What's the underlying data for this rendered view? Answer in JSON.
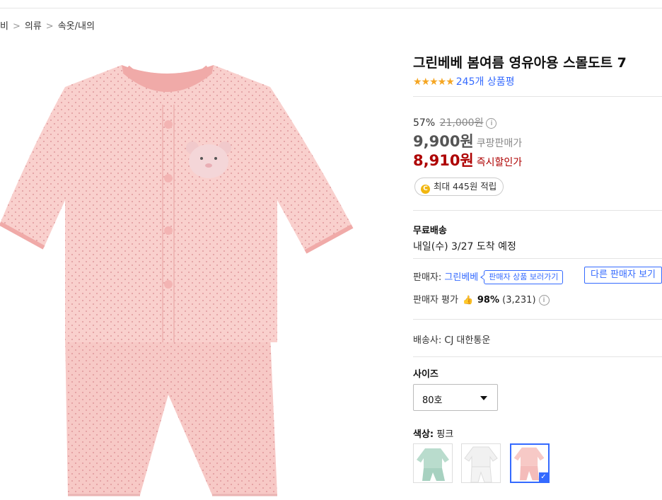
{
  "breadcrumb": {
    "items": [
      "비",
      "의류",
      "속옷/내의"
    ],
    "separator": ">"
  },
  "product": {
    "title": "그린베베 봄여름 영유아용 스몰도트 7",
    "rating_stars": "★★★★★",
    "review_count": "245개 상품평"
  },
  "price": {
    "discount_percent": "57%",
    "original_price": "21,000원",
    "info_icon": "i",
    "coupang_price": "9,900원",
    "coupang_price_label": "쿠팡판매가",
    "instant_price": "8,910원",
    "instant_price_label": "즉시할인가",
    "reward_coin": "C",
    "reward_text": "최대 445원 적립"
  },
  "shipping": {
    "title": "무료배송",
    "arrival": "내일(수) 3/27 도착 예정"
  },
  "seller": {
    "label": "판매자:",
    "name": "그린베베",
    "tooltip": "판매자 상품 보러가기",
    "other_sellers_button": "다른 판매자 보기",
    "rating_label": "판매자 평가",
    "rating_percent": "98%",
    "rating_count": "(3,231)"
  },
  "courier": "배송사: CJ 대한통운",
  "size": {
    "title": "사이즈",
    "selected": "80호"
  },
  "color": {
    "title": "색상:",
    "selected": "핑크"
  },
  "colors": {
    "accent": "#346aff",
    "sale_red": "#ae0000",
    "star": "#f5a623"
  }
}
